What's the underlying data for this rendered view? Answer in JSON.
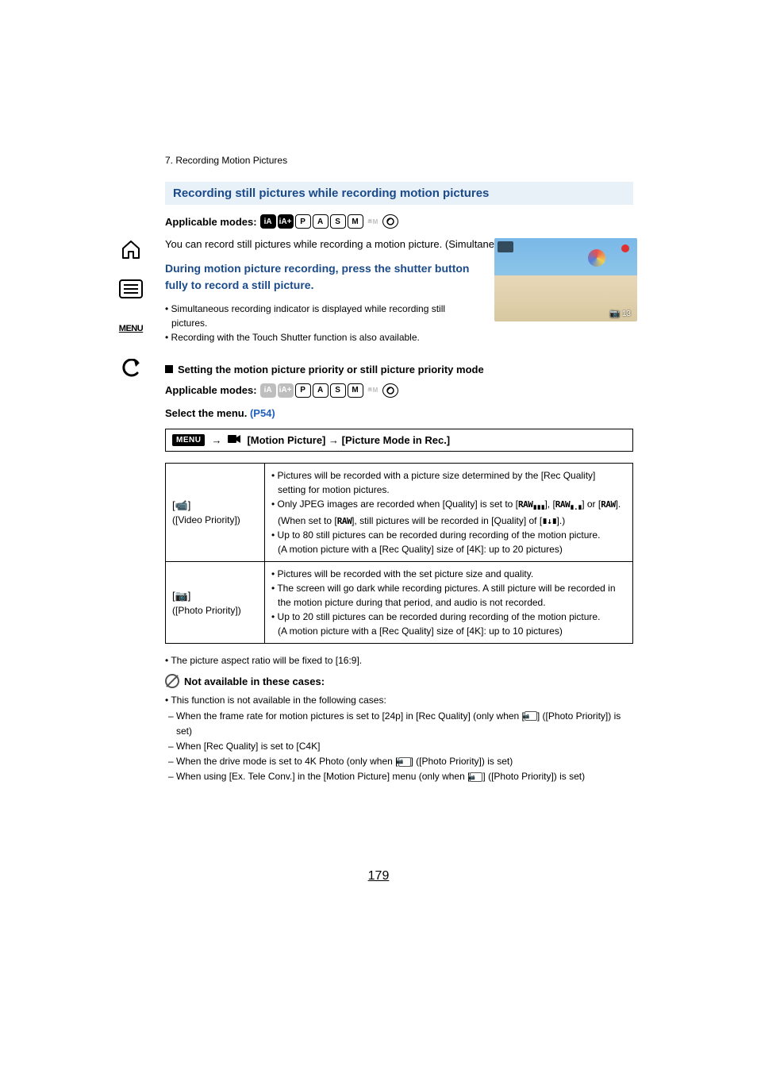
{
  "breadcrumb": "7. Recording Motion Pictures",
  "section_title": "Recording still pictures while recording motion pictures",
  "applicable_label": "Applicable modes:",
  "mode_icons": [
    "iA",
    "iA+",
    "P",
    "A",
    "S",
    "M",
    "MV",
    "C"
  ],
  "intro": "You can record still pictures while recording a motion picture. (Simultaneous recording)",
  "instruction": "During motion picture recording, press the shutter button fully to record a still picture.",
  "instr_bullets": [
    "Simultaneous recording indicator is displayed while recording still pictures.",
    "Recording with the Touch Shutter function is also available."
  ],
  "thumb_counter": "13",
  "subheading": "Setting the motion picture priority or still picture priority mode",
  "select_menu_label": "Select the menu.",
  "select_menu_link": "(P54)",
  "menu_chip": "MENU",
  "menu_path": "[Motion Picture] → [Picture Mode in Rec.]",
  "video_priority": {
    "icon_label": "[📹]",
    "name": "([Video Priority])",
    "points": [
      "Pictures will be recorded with a picture size determined by the [Rec Quality] setting for motion pictures.",
      "Only JPEG images are recorded when [Quality] is set to [RAW+F], [RAW+S] or [RAW].",
      "(When set to [RAW], still pictures will be recorded in [Quality] of [F+S].)",
      "Up to 80 still pictures can be recorded during recording of the motion picture.",
      "(A motion picture with a [Rec Quality] size of [4K]: up to 20 pictures)"
    ]
  },
  "photo_priority": {
    "icon_label": "[📷]",
    "name": "([Photo Priority])",
    "points": [
      "Pictures will be recorded with the set picture size and quality.",
      "The screen will go dark while recording pictures. A still picture will be recorded in the motion picture during that period, and audio is not recorded.",
      "Up to 20 still pictures can be recorded during recording of the motion picture.",
      "(A motion picture with a [Rec Quality] size of [4K]: up to 10 pictures)"
    ]
  },
  "note": "The picture aspect ratio will be fixed to [16:9].",
  "na_heading": "Not available in these cases:",
  "na_top": "This function is not available in the following cases:",
  "na_items": [
    "When the frame rate for motion pictures is set to [24p] in [Rec Quality] (only when [📷] ([Photo Priority]) is set)",
    "When [Rec Quality] is set to [C4K]",
    "When the drive mode is set to 4K Photo (only when [📷] ([Photo Priority]) is set)",
    "When using [Ex. Tele Conv.] in the [Motion Picture] menu (only when [📷] ([Photo Priority]) is set)"
  ],
  "page_number": "179",
  "sidebar": {
    "home": "home-icon",
    "toc": "toc-icon",
    "menu": "MENU",
    "back": "back-icon"
  }
}
